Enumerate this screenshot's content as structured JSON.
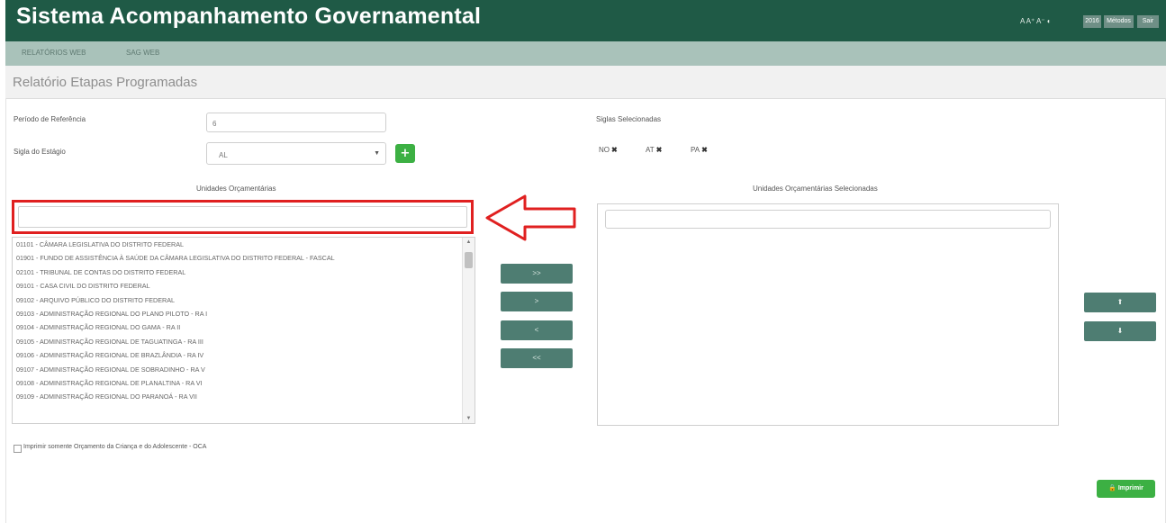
{
  "header": {
    "title": "Sistema Acompanhamento Governamental",
    "font_controls": "A  A⁺ A⁻ ◐",
    "buttons": [
      "2016",
      "Métodos",
      "Sair"
    ]
  },
  "nav": {
    "items": [
      "RELATÓRIOS WEB",
      "SAG WEB"
    ]
  },
  "page": {
    "title": "Relatório Etapas Programadas"
  },
  "form": {
    "periodo_label": "Período de Referência",
    "periodo_value": "6",
    "sigla_estagio_label": "Sigla do Estágio",
    "sigla_estagio_value": "AL",
    "add_button": "+",
    "siglas_selecionadas_label": "Siglas Selecionadas",
    "siglas": [
      {
        "code": "NO",
        "remove": "✖"
      },
      {
        "code": "AT",
        "remove": "✖"
      },
      {
        "code": "PA",
        "remove": "✖"
      }
    ]
  },
  "unidades": {
    "title": "Unidades Orçamentárias",
    "search_value": "",
    "items": [
      "01101 - CÂMARA LEGISLATIVA DO DISTRITO FEDERAL",
      "01901 - FUNDO DE ASSISTÊNCIA À SAÚDE DA CÂMARA LEGISLATIVA DO DISTRITO FEDERAL - FASCAL",
      "02101 - TRIBUNAL DE CONTAS DO DISTRITO FEDERAL",
      "09101 - CASA CIVIL DO DISTRITO FEDERAL",
      "09102 - ARQUIVO PÚBLICO DO DISTRITO FEDERAL",
      "09103 - ADMINISTRAÇÃO REGIONAL DO PLANO PILOTO - RA I",
      "09104 - ADMINISTRAÇÃO REGIONAL DO GAMA - RA II",
      "09105 - ADMINISTRAÇÃO REGIONAL DE TAGUATINGA - RA III",
      "09106 - ADMINISTRAÇÃO REGIONAL DE BRAZLÂNDIA - RA IV",
      "09107 - ADMINISTRAÇÃO REGIONAL DE SOBRADINHO - RA V",
      "09108 - ADMINISTRAÇÃO REGIONAL DE PLANALTINA - RA VI",
      "09109 - ADMINISTRAÇÃO REGIONAL DO PARANOÁ - RA VII"
    ]
  },
  "transfer_buttons": [
    ">>",
    ">",
    "<",
    "<<"
  ],
  "selecionadas": {
    "title": "Unidades Orçamentárias Selecionadas",
    "search_value": ""
  },
  "order_buttons": [
    "⬆",
    "⬇"
  ],
  "footer": {
    "checkbox_label": "Imprimir somente Orçamento da Criança e do Adolescente - OCA",
    "print_button": "Imprimir",
    "print_icon": "lock-icon"
  },
  "colors": {
    "header_bg": "#1f5a46",
    "nav_bg": "#a9c2ba",
    "button_dark": "#4e7d72",
    "button_green": "#3cb043",
    "highlight_red": "#e02020"
  }
}
